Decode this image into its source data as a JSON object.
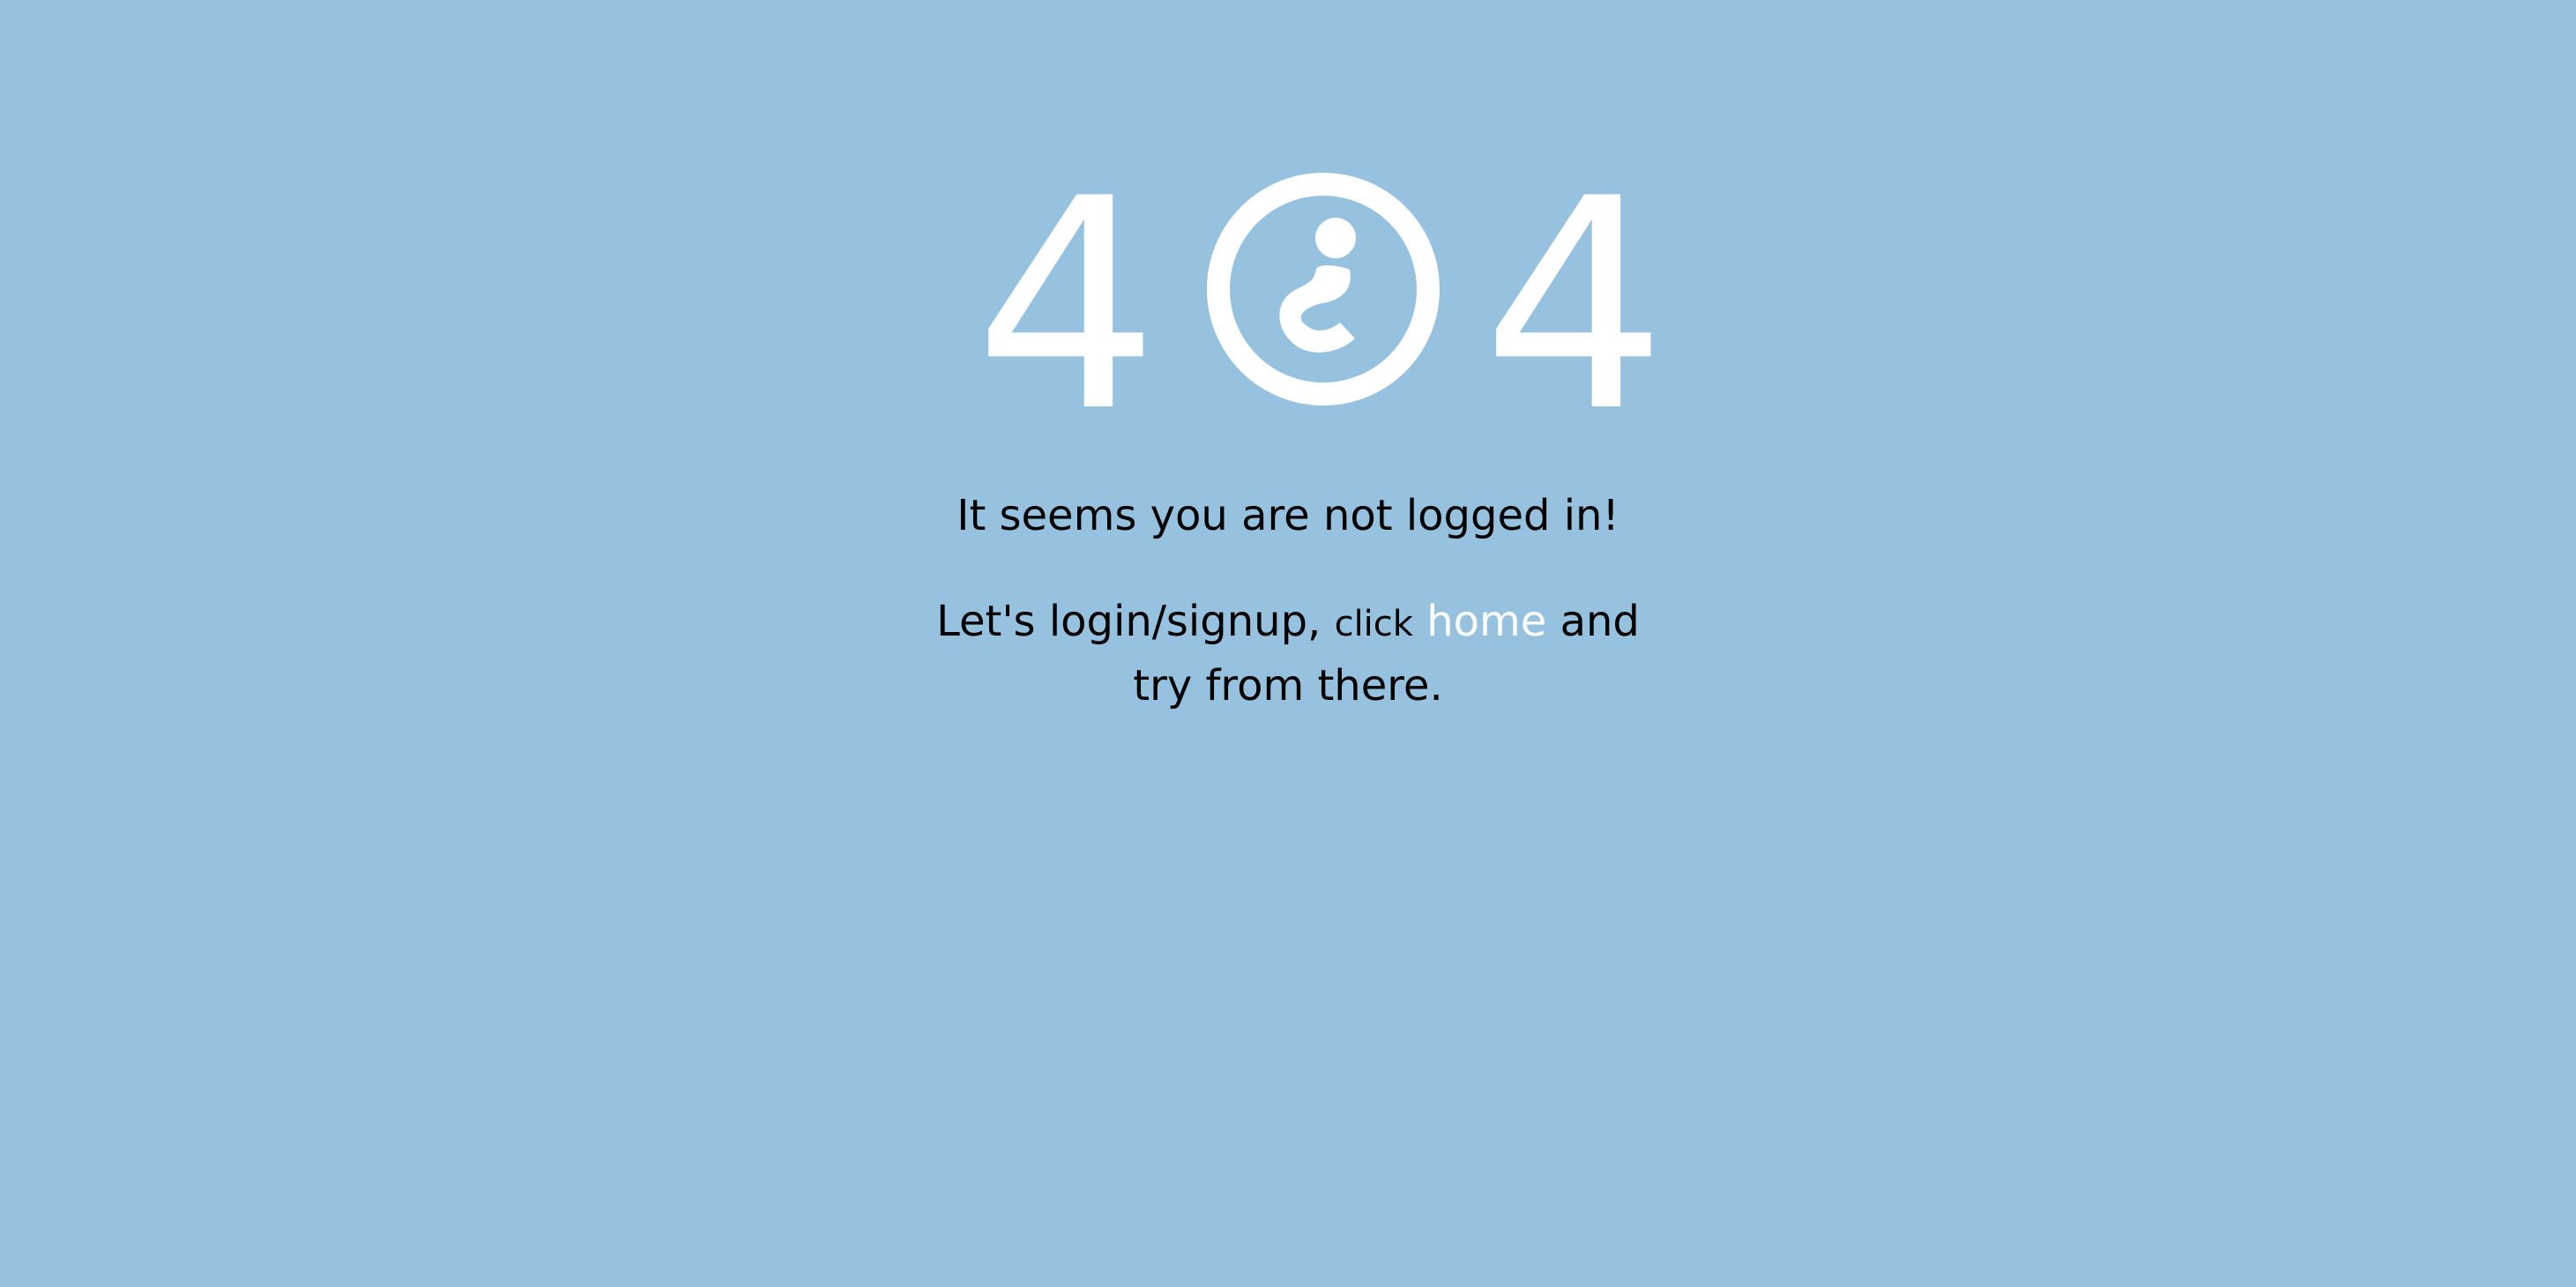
{
  "error": {
    "code_left": "4",
    "code_right": "4",
    "center_icon": "question-circle-icon",
    "icon_color": "#ffffff"
  },
  "message": {
    "line1": "It seems you are not logged in!",
    "line2_prefix": "Let's login/signup,",
    "line2_click": "click",
    "line2_link": "home",
    "line2_suffix": "and try from there."
  },
  "colors": {
    "background": "#96c2e0",
    "text": "#000000",
    "link": "#ffffff"
  }
}
